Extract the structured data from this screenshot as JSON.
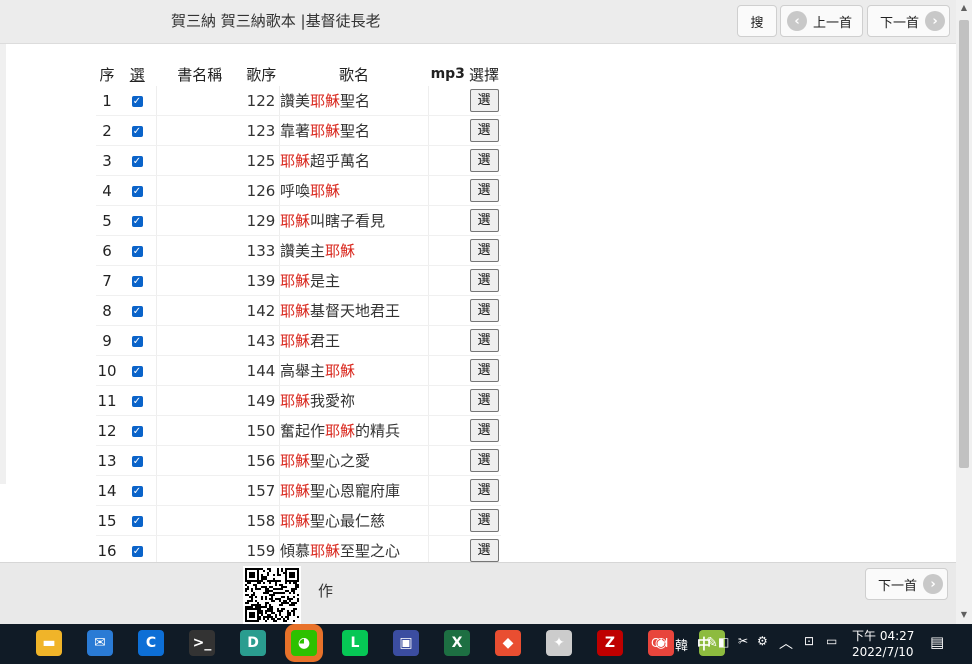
{
  "header": {
    "title": "賀三納 賀三納歌本 |基督徒長老",
    "search_label": "搜",
    "prev_label": "上一首",
    "next_label": "下一首"
  },
  "table": {
    "columns": [
      "序",
      "選",
      "書名稱",
      "歌序",
      "歌名",
      "mp3",
      "選擇"
    ],
    "select_label": "選",
    "rows": [
      {
        "idx": "1",
        "num": "122",
        "parts": [
          [
            "讚美",
            ""
          ],
          [
            "耶穌",
            "red"
          ],
          [
            "聖名",
            ""
          ]
        ]
      },
      {
        "idx": "2",
        "num": "123",
        "parts": [
          [
            "靠著",
            ""
          ],
          [
            "耶穌",
            "red"
          ],
          [
            "聖名",
            ""
          ]
        ]
      },
      {
        "idx": "3",
        "num": "125",
        "parts": [
          [
            "耶穌",
            "red"
          ],
          [
            "超乎萬名",
            ""
          ]
        ]
      },
      {
        "idx": "4",
        "num": "126",
        "parts": [
          [
            "呼喚",
            ""
          ],
          [
            "耶穌",
            "red"
          ]
        ]
      },
      {
        "idx": "5",
        "num": "129",
        "parts": [
          [
            "耶穌",
            "red"
          ],
          [
            "叫瞎子看見",
            ""
          ]
        ]
      },
      {
        "idx": "6",
        "num": "133",
        "parts": [
          [
            "讚美主",
            ""
          ],
          [
            "耶穌",
            "red"
          ]
        ]
      },
      {
        "idx": "7",
        "num": "139",
        "parts": [
          [
            "耶穌",
            "red"
          ],
          [
            "是主",
            ""
          ]
        ]
      },
      {
        "idx": "8",
        "num": "142",
        "parts": [
          [
            "耶穌",
            "red"
          ],
          [
            "基督天地君王",
            ""
          ]
        ]
      },
      {
        "idx": "9",
        "num": "143",
        "parts": [
          [
            "耶穌",
            "red"
          ],
          [
            "君王",
            ""
          ]
        ]
      },
      {
        "idx": "10",
        "num": "144",
        "parts": [
          [
            "高舉主",
            ""
          ],
          [
            "耶穌",
            "red"
          ]
        ]
      },
      {
        "idx": "11",
        "num": "149",
        "parts": [
          [
            "耶穌",
            "red"
          ],
          [
            "我愛祢",
            ""
          ]
        ]
      },
      {
        "idx": "12",
        "num": "150",
        "parts": [
          [
            "奮起作",
            ""
          ],
          [
            "耶穌",
            "red"
          ],
          [
            "的精兵",
            ""
          ]
        ]
      },
      {
        "idx": "13",
        "num": "156",
        "parts": [
          [
            "耶穌",
            "red"
          ],
          [
            "聖心之愛",
            ""
          ]
        ]
      },
      {
        "idx": "14",
        "num": "157",
        "parts": [
          [
            "耶穌",
            "red"
          ],
          [
            "聖心恩寵府庫",
            ""
          ]
        ]
      },
      {
        "idx": "15",
        "num": "158",
        "parts": [
          [
            "耶穌",
            "red"
          ],
          [
            "聖心最仁慈",
            ""
          ]
        ]
      },
      {
        "idx": "16",
        "num": "159",
        "parts": [
          [
            "傾慕",
            ""
          ],
          [
            "耶穌",
            "red"
          ],
          [
            "至聖之心",
            ""
          ]
        ]
      }
    ]
  },
  "footer": {
    "author_label": "作",
    "next_label": "下一首"
  },
  "taskbar": {
    "apps": [
      {
        "name": "file-explorer-icon",
        "bg": "#f0b429",
        "glyph": "▬"
      },
      {
        "name": "mail-icon",
        "bg": "#2a7bd5",
        "glyph": "✉"
      },
      {
        "name": "c-app-icon",
        "bg": "#0d6fd6",
        "glyph": "C"
      },
      {
        "name": "terminal-icon",
        "bg": "#333333",
        "glyph": ">_"
      },
      {
        "name": "d-app-icon",
        "bg": "#2a9d8f",
        "glyph": "D"
      },
      {
        "name": "wechat-icon",
        "bg": "#2dc100",
        "glyph": "◕"
      },
      {
        "name": "line-icon",
        "bg": "#06c755",
        "glyph": "L"
      },
      {
        "name": "save-app-icon",
        "bg": "#3b4da0",
        "glyph": "▣"
      },
      {
        "name": "excel-icon",
        "bg": "#1d6f42",
        "glyph": "X"
      },
      {
        "name": "git-icon",
        "bg": "#e94e31",
        "glyph": "◆"
      },
      {
        "name": "puzzle-app-icon",
        "bg": "#cccccc",
        "glyph": "✦"
      },
      {
        "name": "filezilla-icon",
        "bg": "#bf0000",
        "glyph": "Z"
      },
      {
        "name": "chrome-icon",
        "bg": "#e8453c",
        "glyph": "◉"
      },
      {
        "name": "notepad-icon",
        "bg": "#8dbb3f",
        "glyph": "✎"
      }
    ],
    "lang": "CH",
    "ime1": "韓",
    "ime2": "中",
    "time": "下午 04:27",
    "date": "2022/7/10"
  }
}
